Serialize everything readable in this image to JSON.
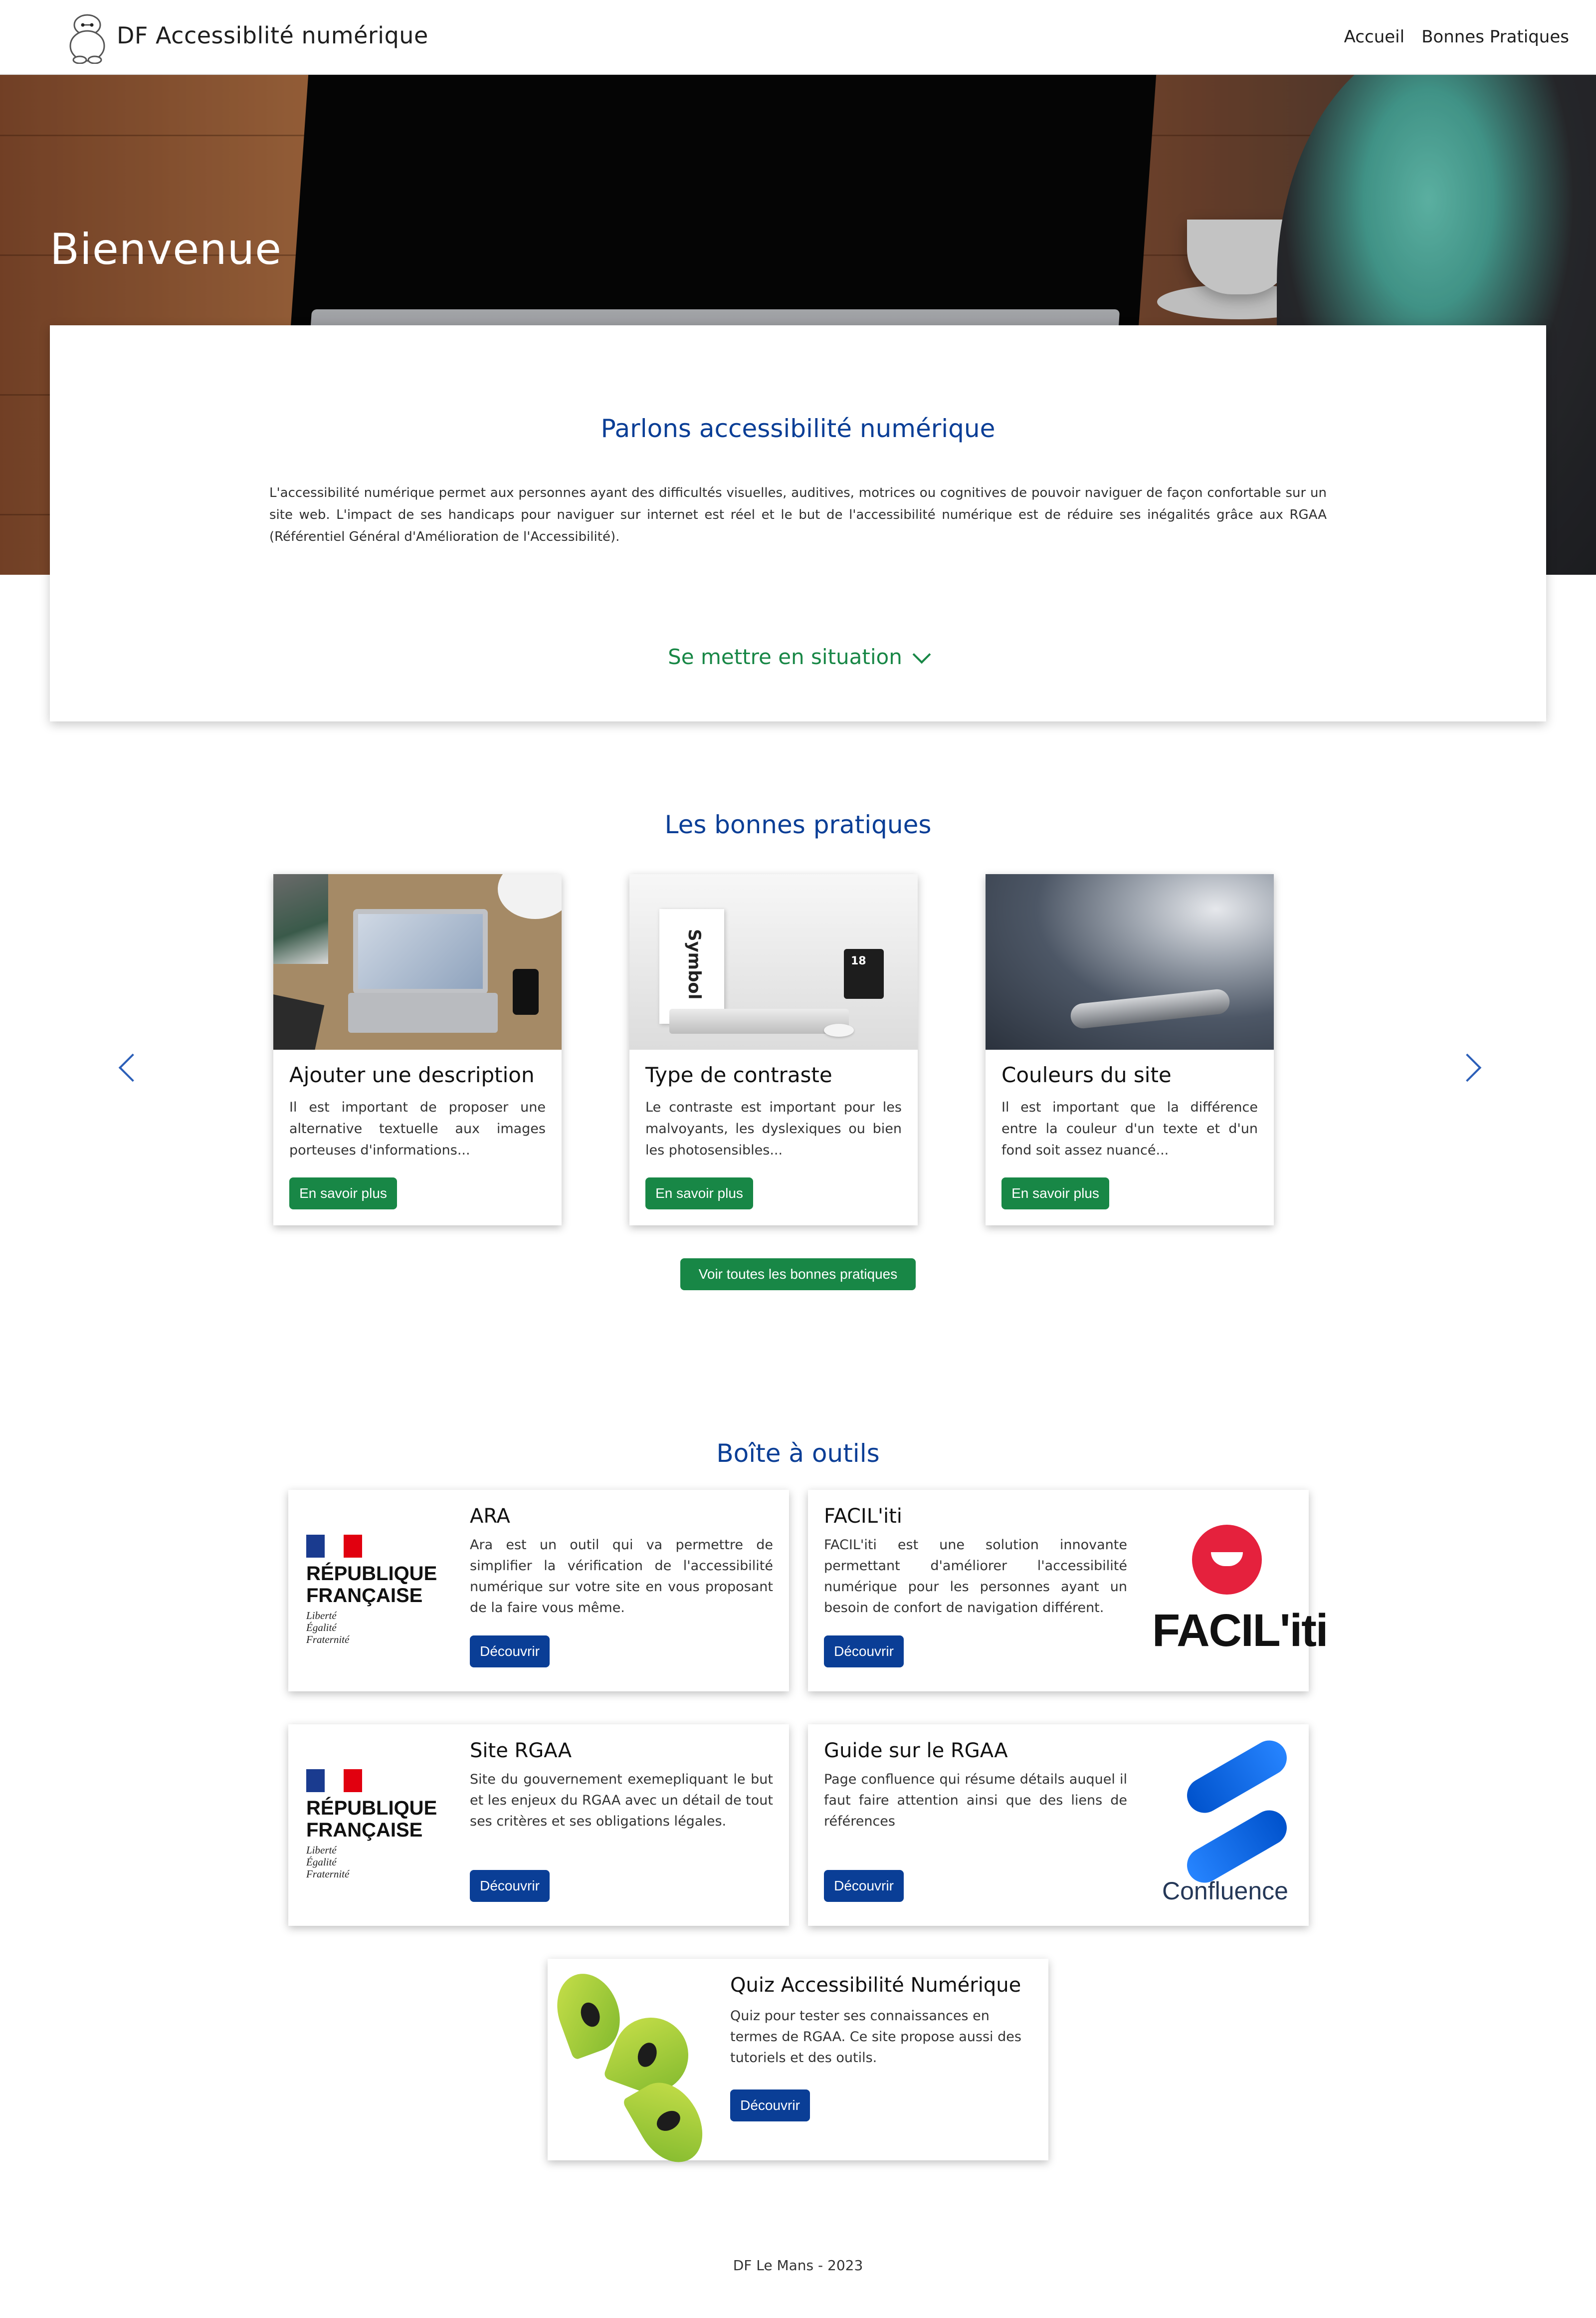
{
  "header": {
    "brand": "DF Accessiblité numérique",
    "nav": [
      "Accueil",
      "Bonnes Pratiques"
    ]
  },
  "hero": {
    "title": "Bienvenue"
  },
  "intro": {
    "title": "Parlons accessibilité numérique",
    "text": "L'accessibilité numérique permet aux personnes ayant des difficultés visuelles, auditives, motrices ou cognitives de pouvoir naviguer de façon confortable sur un site web. L'impact de ses handicaps pour naviguer sur internet est réel et le but de l'accessibilité numérique est de réduire ses inégalités grâce aux RGAA (Référentiel Général d'Amélioration de l'Accessibilité).",
    "situation_label": "Se mettre en situation"
  },
  "bonnes_pratiques": {
    "title": "Les bonnes pratiques",
    "cards": [
      {
        "title": "Ajouter une description",
        "text": "Il est important de proposer une alternative textuelle aux images porteuses d'informations...",
        "button": "En savoir plus"
      },
      {
        "title": "Type de contraste",
        "text": "Le contraste est important pour les malvoyants, les dyslexiques ou bien les photosensibles...",
        "button": "En savoir plus"
      },
      {
        "title": "Couleurs du site",
        "text": "Il est important que la différence entre la couleur d'un texte et d'un fond soit assez nuancé...",
        "button": "En savoir plus"
      }
    ],
    "see_all": "Voir toutes les bonnes pratiques",
    "image_labels": {
      "symbol": "Symbol",
      "calendar": "18"
    }
  },
  "outils": {
    "title": "Boîte à outils",
    "republique": {
      "line1": "RÉPUBLIQUE",
      "line2": "FRANÇAISE",
      "motto1": "Liberté",
      "motto2": "Égalité",
      "motto3": "Fraternité"
    },
    "items": [
      {
        "title": "ARA",
        "text": "Ara est un outil qui va permettre de simplifier la vérification de l'accessibilité numérique sur votre site en vous proposant de la faire vous même.",
        "button": "Découvrir"
      },
      {
        "title": "FACIL'iti",
        "text": "FACIL'iti est une solution innovante permettant d'améliorer l'accessibilité numérique pour les personnes ayant un besoin de confort de navigation différent.",
        "button": "Découvrir",
        "logo_text": "FACIL'iti"
      },
      {
        "title": "Site RGAA",
        "text": "Site du gouvernement exemepliquant le but et les enjeux du RGAA avec un détail de tout ses critères et ses obligations légales.",
        "button": "Découvrir"
      },
      {
        "title": "Guide sur le RGAA",
        "text": "Page confluence qui résume détails auquel il faut faire attention ainsi que des liens de références",
        "button": "Découvrir",
        "logo_text": "Confluence"
      },
      {
        "title": "Quiz Accessibilité Numérique",
        "text": "Quiz pour tester ses connaissances en termes de RGAA. Ce site propose aussi des tutoriels et des outils.",
        "button": "Découvrir"
      }
    ]
  },
  "footer": {
    "text": "DF Le Mans - 2023"
  },
  "colors": {
    "primary_blue": "#0a3e96",
    "green": "#188746"
  }
}
